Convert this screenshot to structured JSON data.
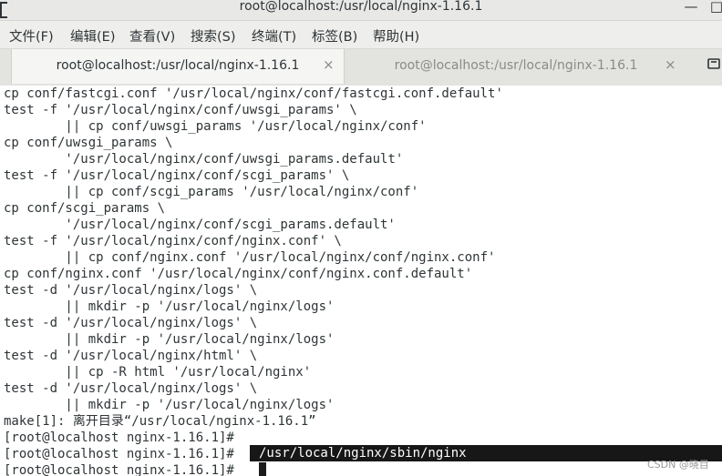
{
  "window": {
    "title": "root@localhost:/usr/local/nginx-1.16.1",
    "minimize_glyph": "—",
    "maximize_glyph": "□"
  },
  "menu": [
    "文件(F)",
    "编辑(E)",
    "查看(V)",
    "搜索(S)",
    "终端(T)",
    "标签(B)",
    "帮助(H)"
  ],
  "tabs": [
    {
      "label": "root@localhost:/usr/local/nginx-1.16.1",
      "active": true,
      "close": "×"
    },
    {
      "label": "root@localhost:/usr/local/nginx-1.16.1",
      "active": false,
      "close": "×"
    }
  ],
  "terminal": {
    "lines": [
      "cp conf/fastcgi.conf '/usr/local/nginx/conf/fastcgi.conf.default'",
      "test -f '/usr/local/nginx/conf/uwsgi_params' \\",
      "        || cp conf/uwsgi_params '/usr/local/nginx/conf'",
      "cp conf/uwsgi_params \\",
      "        '/usr/local/nginx/conf/uwsgi_params.default'",
      "test -f '/usr/local/nginx/conf/scgi_params' \\",
      "        || cp conf/scgi_params '/usr/local/nginx/conf'",
      "cp conf/scgi_params \\",
      "        '/usr/local/nginx/conf/scgi_params.default'",
      "test -f '/usr/local/nginx/conf/nginx.conf' \\",
      "        || cp conf/nginx.conf '/usr/local/nginx/conf/nginx.conf'",
      "cp conf/nginx.conf '/usr/local/nginx/conf/nginx.conf.default'",
      "test -d '/usr/local/nginx/logs' \\",
      "        || mkdir -p '/usr/local/nginx/logs'",
      "test -d '/usr/local/nginx/logs' \\",
      "        || mkdir -p '/usr/local/nginx/logs'",
      "test -d '/usr/local/nginx/html' \\",
      "        || cp -R html '/usr/local/nginx'",
      "test -d '/usr/local/nginx/logs' \\",
      "        || mkdir -p '/usr/local/nginx/logs'",
      "make[1]: 离开目录“/usr/local/nginx-1.16.1”",
      "[root@localhost nginx-1.16.1]# ",
      "[root@localhost nginx-1.16.1]# ",
      "[root@localhost nginx-1.16.1]# "
    ],
    "highlighted_command": "/usr/local/nginx/sbin/nginx"
  },
  "watermark": "CSDN @晓目"
}
